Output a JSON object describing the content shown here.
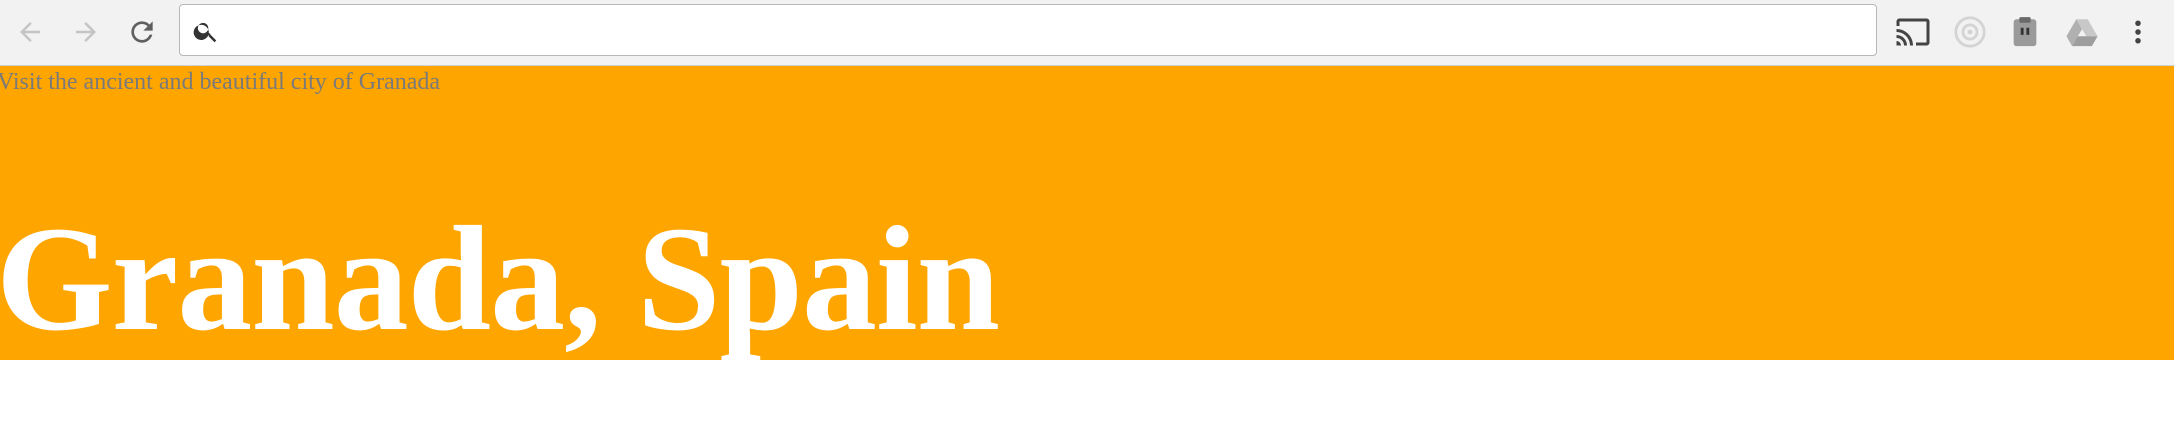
{
  "browser": {
    "address_bar": {
      "value": "",
      "placeholder": ""
    },
    "icons": {
      "back": "arrow-left-icon",
      "forward": "arrow-right-icon",
      "reload": "reload-icon",
      "search": "search-icon",
      "cast": "cast-icon",
      "extension_2": "circle-extension-icon",
      "extension_3": "clipboard-extension-icon",
      "drive": "drive-icon",
      "menu": "more-vertical-icon"
    }
  },
  "page": {
    "tagline": "Visit the ancient and beautiful city of Granada",
    "title": "Granada, Spain",
    "colors": {
      "hero_background": "#ffa500",
      "title_text": "#ffffff",
      "tagline_text": "#7a7a7a"
    }
  }
}
